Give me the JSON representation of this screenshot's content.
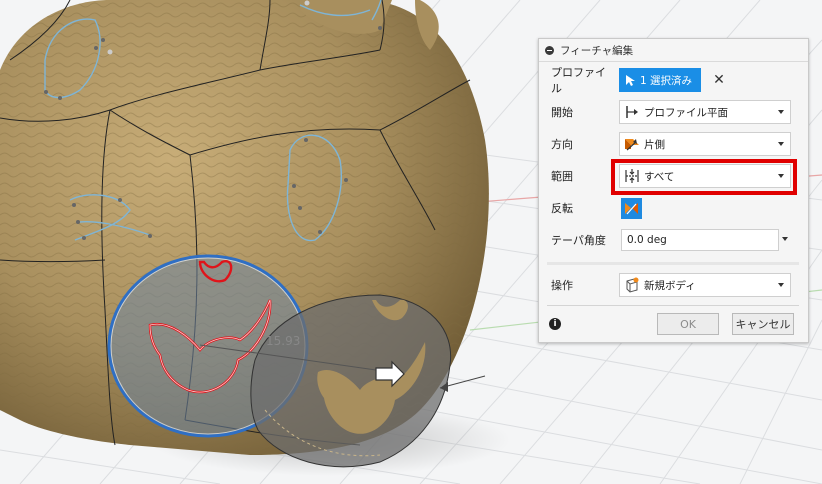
{
  "panel": {
    "title": "フィーチャ編集",
    "rows": {
      "profile": {
        "label": "プロファイル",
        "value": "1 選択済み"
      },
      "start": {
        "label": "開始",
        "value": "プロファイル平面"
      },
      "direction": {
        "label": "方向",
        "value": "片側"
      },
      "extent": {
        "label": "範囲",
        "value": "すべて"
      },
      "flip": {
        "label": "反転"
      },
      "taper": {
        "label": "テーパ角度",
        "value": "0.0 deg"
      },
      "operation": {
        "label": "操作",
        "value": "新規ボディ"
      }
    },
    "buttons": {
      "ok": "OK",
      "cancel": "キャンセル"
    }
  },
  "viewport": {
    "dimension_label": "15.93"
  },
  "colors": {
    "accent": "#1a8ee6",
    "highlight": "#e00000",
    "body_fill": "#a88f5e"
  },
  "icons": {
    "collapse": "minus-circle-icon",
    "cursor": "cursor-icon",
    "close": "close-icon",
    "start_plane": "profile-plane-icon",
    "direction": "one-side-icon",
    "extent": "extent-all-icon",
    "flip": "flip-icon",
    "operation": "new-body-icon",
    "info": "info-icon"
  }
}
